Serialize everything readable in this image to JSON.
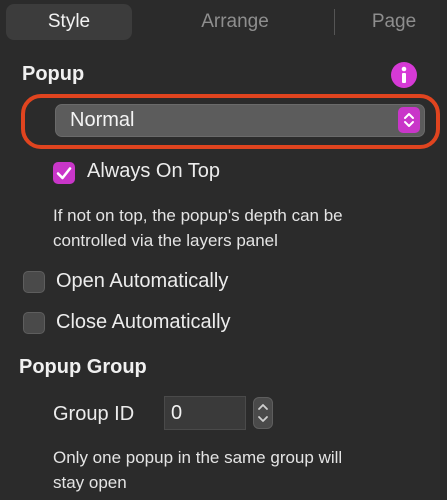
{
  "tabs": [
    {
      "label": "Style"
    },
    {
      "label": "Arrange"
    },
    {
      "label": "Page"
    }
  ],
  "popup": {
    "title": "Popup",
    "mode_value": "Normal",
    "always_on_top": {
      "label": "Always On Top",
      "checked": true
    },
    "help_text_1": "If not on top, the popup's depth can be",
    "help_text_2": "controlled via the layers panel",
    "open_auto": {
      "label": "Open Automatically",
      "checked": false
    },
    "close_auto": {
      "label": "Close Automatically",
      "checked": false
    }
  },
  "popup_group": {
    "title": "Popup Group",
    "group_id_label": "Group ID",
    "group_id_value": "0",
    "help_text_1": "Only one popup in the same group will",
    "help_text_2": "stay open"
  },
  "colors": {
    "accent": "#c936c9",
    "highlight": "#e0441f",
    "background": "#2b2b2b"
  },
  "icons": [
    "info-icon",
    "up-down-chevron-icon",
    "checkmark-icon"
  ]
}
